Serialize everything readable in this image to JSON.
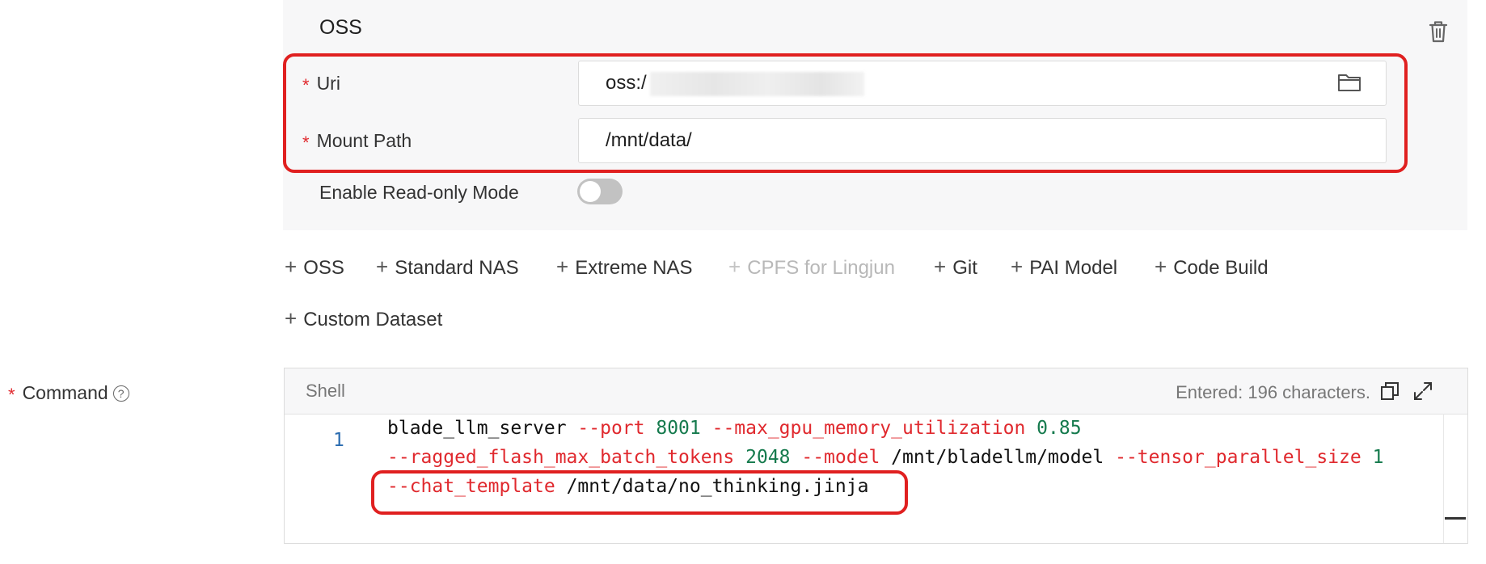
{
  "oss_panel": {
    "title": "OSS",
    "uri": {
      "label": "Uri",
      "value": "oss:/"
    },
    "mount_path": {
      "label": "Mount Path",
      "value": "/mnt/data/"
    },
    "read_only": {
      "label": "Enable Read-only Mode",
      "enabled": false
    },
    "icons": {
      "delete": "trash-icon",
      "browse": "folder-icon"
    }
  },
  "add_buttons": [
    {
      "label": "OSS",
      "enabled": true
    },
    {
      "label": "Standard NAS",
      "enabled": true
    },
    {
      "label": "Extreme NAS",
      "enabled": true
    },
    {
      "label": "CPFS for Lingjun",
      "enabled": false
    },
    {
      "label": "Git",
      "enabled": true
    },
    {
      "label": "PAI Model",
      "enabled": true
    },
    {
      "label": "Code Build",
      "enabled": true
    },
    {
      "label": "Custom Dataset",
      "enabled": true
    }
  ],
  "command": {
    "label": "Command",
    "help_icon": "question-circle-icon",
    "language": "Shell",
    "counter": "Entered: 196 characters.",
    "line_number": "1",
    "lines": [
      [
        {
          "t": "blade_llm_server ",
          "c": "plain"
        },
        {
          "t": "--port ",
          "c": "flag"
        },
        {
          "t": "8001 ",
          "c": "num"
        },
        {
          "t": "--max_gpu_memory_utilization ",
          "c": "flag"
        },
        {
          "t": "0.85",
          "c": "num"
        }
      ],
      [
        {
          "t": "--ragged_flash_max_batch_tokens ",
          "c": "flag"
        },
        {
          "t": "2048 ",
          "c": "num"
        },
        {
          "t": "--model ",
          "c": "flag"
        },
        {
          "t": "/mnt/bladellm/model ",
          "c": "plain"
        },
        {
          "t": "--tensor_parallel_size ",
          "c": "flag"
        },
        {
          "t": "1",
          "c": "num"
        }
      ],
      [
        {
          "t": "--chat_template ",
          "c": "flag"
        },
        {
          "t": "/mnt/data/no_thinking.jinja",
          "c": "plain"
        }
      ]
    ]
  },
  "colors": {
    "required": "#e0292e",
    "highlight_box": "#e02020",
    "code_flag": "#e0292e",
    "code_number": "#157a4d",
    "line_number": "#2b6cb0",
    "panel_bg": "#f7f7f8"
  }
}
